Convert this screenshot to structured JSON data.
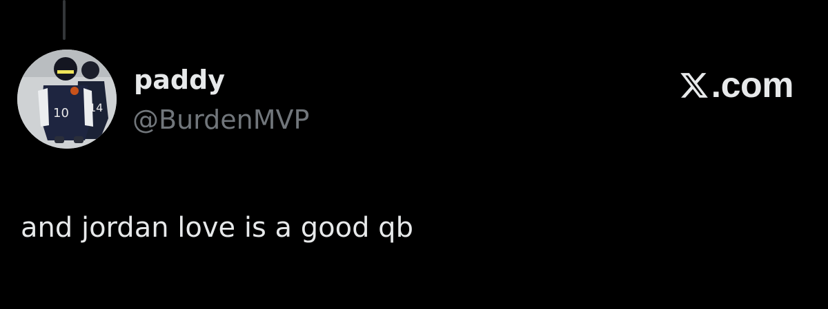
{
  "brand": {
    "logo_icon": "x-logo-icon",
    "label": ".com"
  },
  "author": {
    "display_name": "paddy",
    "handle": "@BurdenMVP",
    "avatar_icon": "football-player-avatar"
  },
  "tweet": {
    "text": "and jordan love is a good qb"
  },
  "colors": {
    "background": "#000000",
    "primary_text": "#e7e9ea",
    "secondary_text": "#71767b",
    "thread_line": "#333639"
  }
}
